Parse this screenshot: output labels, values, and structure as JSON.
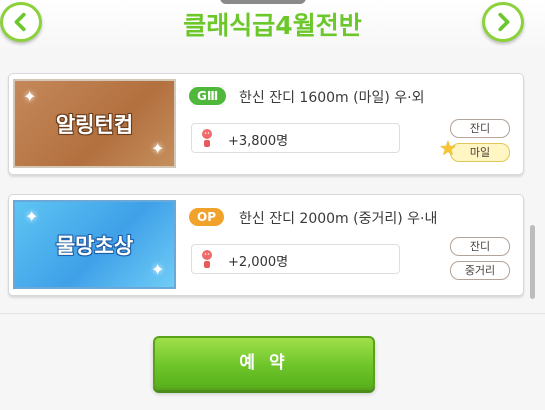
{
  "header": {
    "title": "클래식급4월전반",
    "prev_icon": "chevron-left-icon",
    "next_icon": "chevron-right-icon"
  },
  "races": [
    {
      "name": "알링턴컵",
      "grade": "GⅢ",
      "info": "한신 잔디 1600m (마일) 우·외",
      "fans": "+3,800명",
      "tags": [
        "잔디",
        "마일"
      ],
      "highlighted_tag": "마일"
    },
    {
      "name": "물망초상",
      "grade": "OP",
      "info": "한신 잔디 2000m (중거리) 우·내",
      "fans": "+2,000명",
      "tags": [
        "잔디",
        "중거리"
      ],
      "highlighted_tag": ""
    }
  ],
  "footer": {
    "reserve_label": "예 약"
  },
  "colors": {
    "accent_green": "#6cc72a",
    "grade_g3": "#4fb73a",
    "grade_op": "#f0a22a"
  }
}
